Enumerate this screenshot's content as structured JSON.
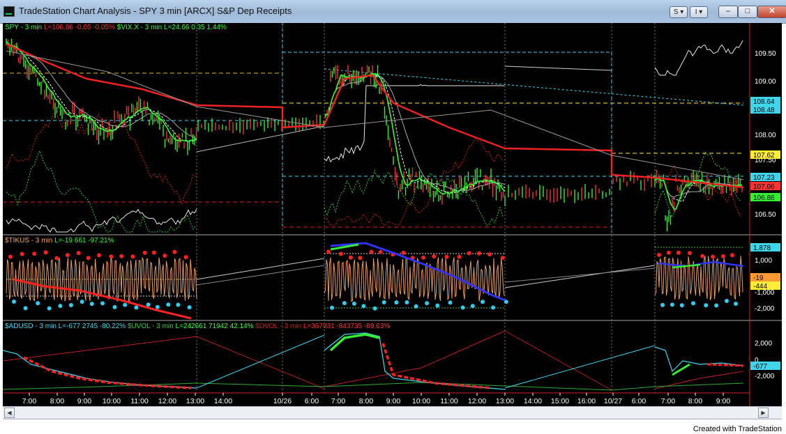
{
  "window": {
    "title": "TradeStation Chart Analysis - SPY 3 min [ARCX] S&P Dep Receipts",
    "controls": {
      "symbol_button": "S",
      "indicator_button": "I",
      "minimize": "–",
      "maximize": "□",
      "close": "✕"
    }
  },
  "panes": {
    "price": {
      "legend": [
        {
          "text": "SPY - 3 min",
          "color": "#33ff33"
        },
        {
          "text": "L=106.86",
          "color": "#ff3333"
        },
        {
          "text": "-0.05",
          "color": "#ff3333"
        },
        {
          "text": "-0.05%",
          "color": "#ff3333"
        },
        {
          "text": "$VIX.X - 3 min",
          "color": "#33ff33"
        },
        {
          "text": "L=24.66",
          "color": "#33ff33"
        },
        {
          "text": "0.35",
          "color": "#33ff33"
        },
        {
          "text": "1.44%",
          "color": "#33ff33"
        }
      ],
      "axis_labels": [
        "109.50",
        "109.00",
        "108.00",
        "107.50",
        "106.50"
      ],
      "badges": [
        {
          "text": "108.64",
          "bg": "#3fd6ec"
        },
        {
          "text": "108.48",
          "bg": "#3fd6ec"
        },
        {
          "text": "107.62",
          "bg": "#ffee33"
        },
        {
          "text": "107.23",
          "bg": "#3fd6ec"
        },
        {
          "text": "107.06",
          "bg": "#ff3333"
        },
        {
          "text": "106.86",
          "bg": "#33ee33"
        }
      ]
    },
    "tick": {
      "legend": [
        {
          "text": "$TIKUS - 3 min",
          "color": "#f5a55a"
        },
        {
          "text": "L=-19",
          "color": "#33ff33"
        },
        {
          "text": "661",
          "color": "#33ff33"
        },
        {
          "text": "-97.21%",
          "color": "#33ff33"
        }
      ],
      "axis_labels": [
        "1,000",
        "-1,000",
        "-2,000"
      ],
      "badges": [
        {
          "text": "1,878",
          "bg": "#3fd6ec"
        },
        {
          "text": "-19",
          "bg": "#ff9933"
        },
        {
          "text": "-444",
          "bg": "#ffee33"
        }
      ]
    },
    "breadth": {
      "legend": [
        {
          "text": "$ADUSD - 3 min",
          "color": "#3fd6ec"
        },
        {
          "text": "L=-677",
          "color": "#3fd6ec"
        },
        {
          "text": "2745",
          "color": "#3fd6ec"
        },
        {
          "text": "-80.22%",
          "color": "#3fd6ec"
        },
        {
          "text": "$UVOL - 3 min",
          "color": "#33cc33"
        },
        {
          "text": "L=242661",
          "color": "#33ff33"
        },
        {
          "text": "71942",
          "color": "#33ff33"
        },
        {
          "text": "42.14%",
          "color": "#33ff33"
        },
        {
          "text": "$DVOL - 3 min",
          "color": "#cc2222"
        },
        {
          "text": "L=367931",
          "color": "#ff3333"
        },
        {
          "text": "-843735",
          "color": "#ff3333"
        },
        {
          "text": "-89.63%",
          "color": "#ff3333"
        }
      ],
      "axis_labels": [
        "2,000",
        "0",
        "-2,000"
      ],
      "badges": [
        {
          "text": "-677",
          "bg": "#3fd6ec"
        }
      ]
    }
  },
  "time_axis": [
    "7:00",
    "8:00",
    "9:00",
    "10:00",
    "11:00",
    "12:00",
    "13:00",
    "14:00",
    "10/26",
    "6:00",
    "7:00",
    "8:00",
    "9:00",
    "10:00",
    "11:00",
    "12:00",
    "13:00",
    "14:00",
    "15:00",
    "16:00",
    "10/27",
    "6:00",
    "7:00",
    "8:00",
    "9:00"
  ],
  "footer": {
    "credit": "Created with TradeStation"
  }
}
